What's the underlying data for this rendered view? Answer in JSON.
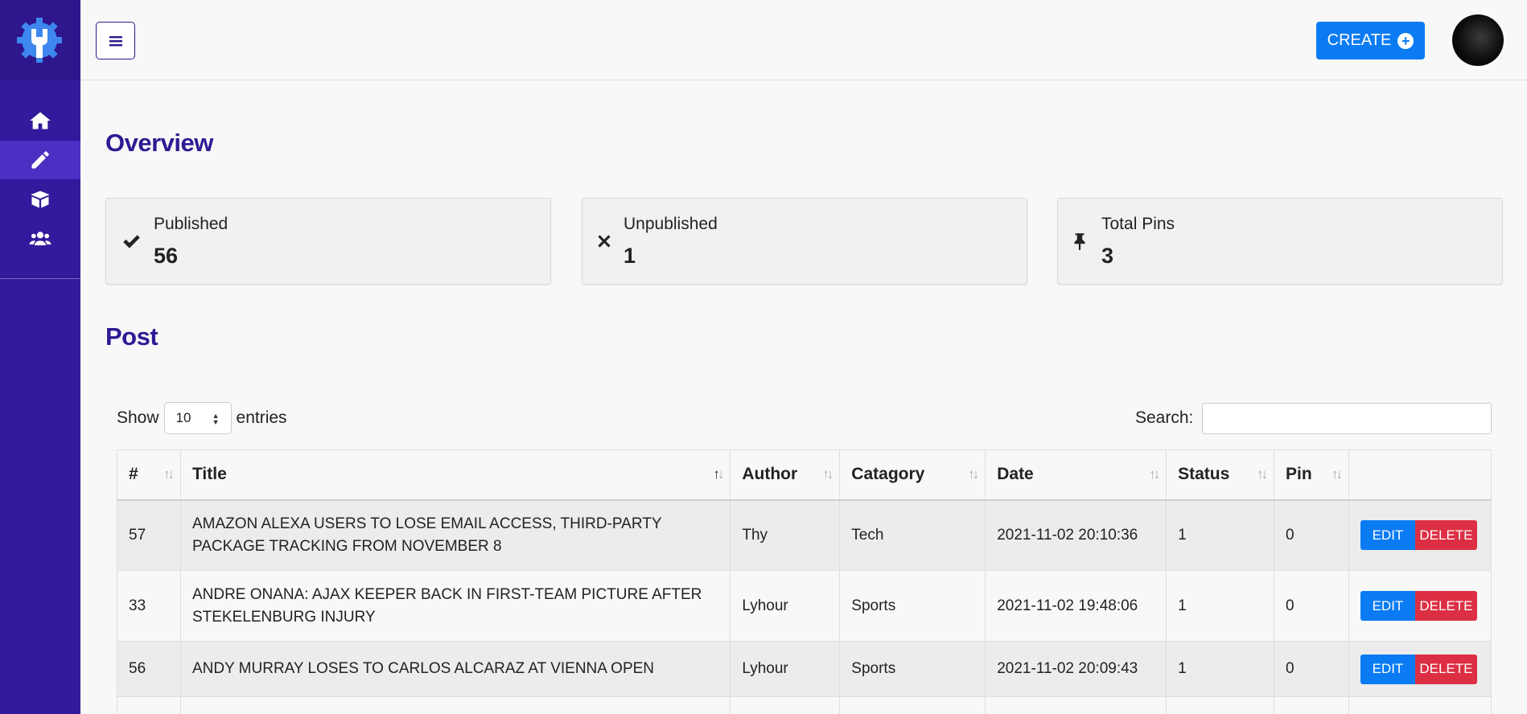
{
  "header": {
    "create_label": "CREATE"
  },
  "sections": {
    "overview_title": "Overview",
    "post_title": "Post"
  },
  "stats": [
    {
      "label": "Published",
      "value": "56",
      "icon": "check-icon"
    },
    {
      "label": "Unpublished",
      "value": "1",
      "icon": "x-icon"
    },
    {
      "label": "Total Pins",
      "value": "3",
      "icon": "pin-icon"
    }
  ],
  "table_controls": {
    "show_label": "Show",
    "entries_value": "10",
    "entries_label": "entries",
    "search_label": "Search:"
  },
  "table": {
    "columns": [
      "#",
      "Title",
      "Author",
      "Catagory",
      "Date",
      "Status",
      "Pin"
    ],
    "edit_label": "EDIT",
    "delete_label": "DELETE",
    "rows": [
      {
        "id": "57",
        "title": "AMAZON ALEXA USERS TO LOSE EMAIL ACCESS, THIRD-PARTY PACKAGE TRACKING FROM NOVEMBER 8",
        "author": "Thy",
        "category": "Tech",
        "date": "2021-11-02 20:10:36",
        "status": "1",
        "pin": "0"
      },
      {
        "id": "33",
        "title": "ANDRE ONANA: AJAX KEEPER BACK IN FIRST-TEAM PICTURE AFTER STEKELENBURG INJURY",
        "author": "Lyhour",
        "category": "Sports",
        "date": "2021-11-02 19:48:06",
        "status": "1",
        "pin": "0"
      },
      {
        "id": "56",
        "title": "ANDY MURRAY LOSES TO CARLOS ALCARAZ AT VIENNA OPEN",
        "author": "Lyhour",
        "category": "Sports",
        "date": "2021-11-02 20:09:43",
        "status": "1",
        "pin": "0"
      }
    ]
  },
  "colors": {
    "sidebar": "#33199b",
    "accent_title": "#2f1a93",
    "primary": "#0b7bf3",
    "danger": "#dd2f43"
  }
}
